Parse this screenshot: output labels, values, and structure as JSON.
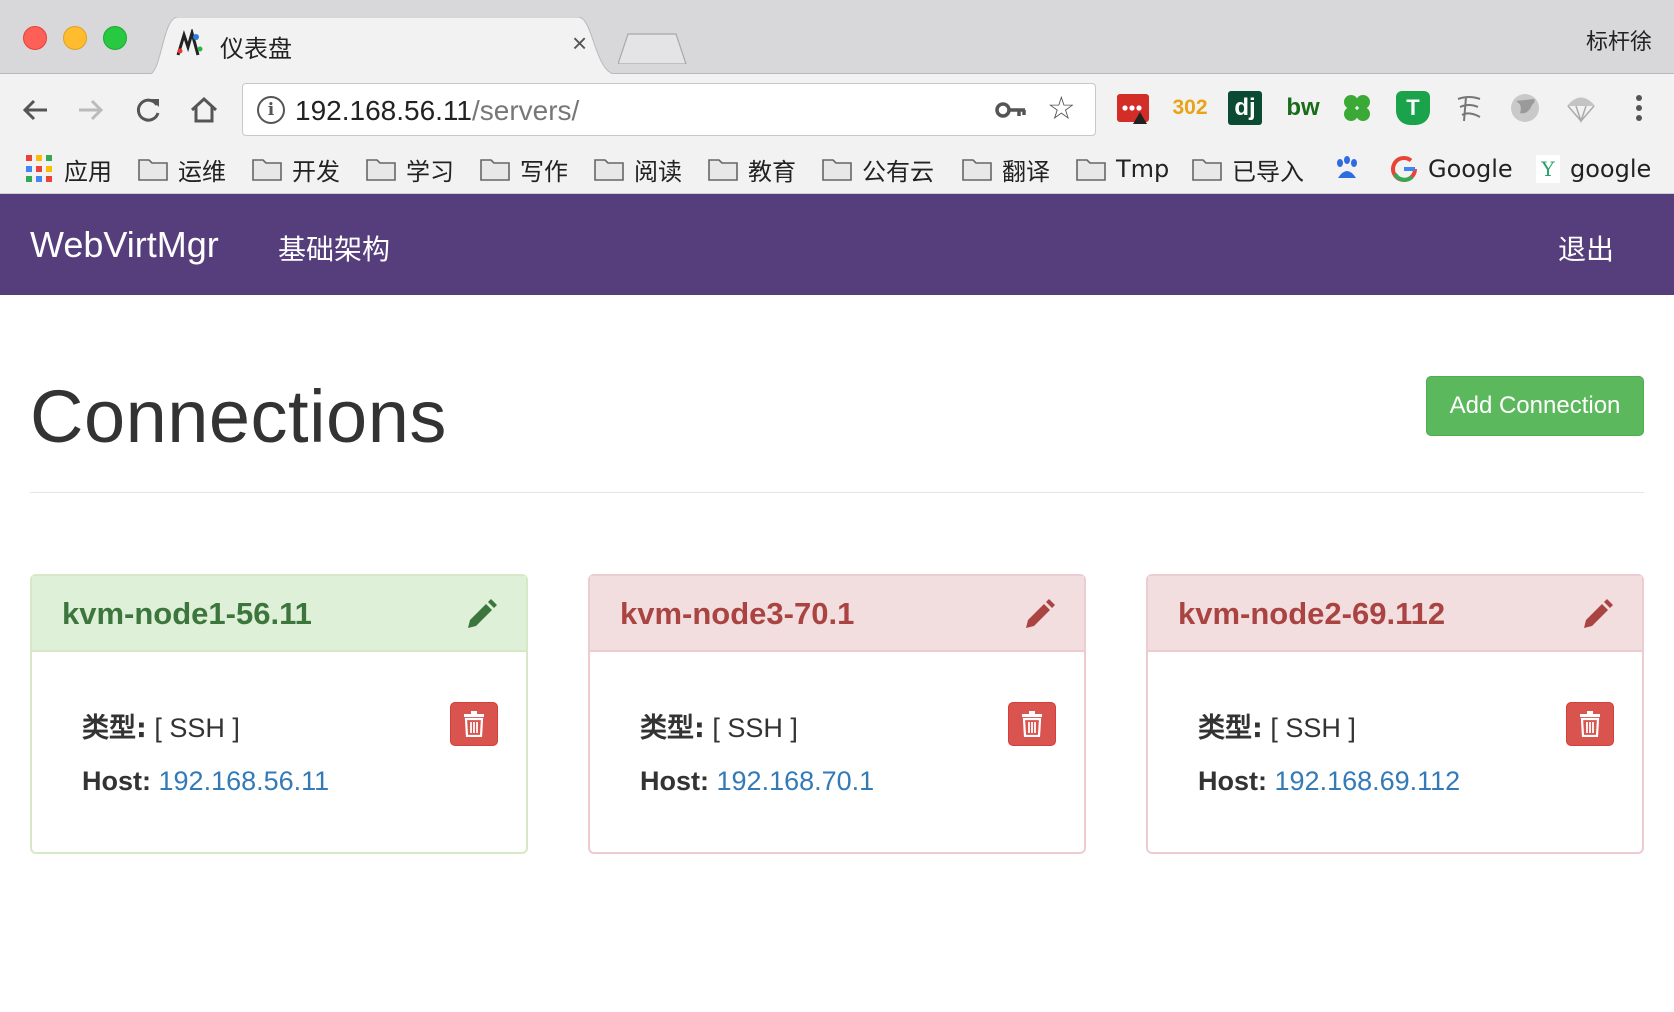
{
  "browser": {
    "tab_title": "仪表盘",
    "tab_close": "×",
    "profile_name": "标杆徐",
    "url_host": "192.168.56.11",
    "url_path": "/servers/",
    "info_glyph": "i",
    "bookmarks": [
      {
        "label": "应用",
        "kind": "apps"
      },
      {
        "label": "运维",
        "kind": "folder"
      },
      {
        "label": "开发",
        "kind": "folder"
      },
      {
        "label": "学习",
        "kind": "folder"
      },
      {
        "label": "写作",
        "kind": "folder"
      },
      {
        "label": "阅读",
        "kind": "folder"
      },
      {
        "label": "教育",
        "kind": "folder"
      },
      {
        "label": "公有云",
        "kind": "folder"
      },
      {
        "label": "翻译",
        "kind": "folder"
      },
      {
        "label": "Tmp",
        "kind": "folder"
      },
      {
        "label": "已导入",
        "kind": "folder"
      },
      {
        "label": "Google",
        "kind": "google"
      },
      {
        "label": "google",
        "kind": "yahoo"
      }
    ],
    "extensions": {
      "ext2_text": "302",
      "ext3_text": "dj",
      "ext4_text": "bw",
      "ext6_text": "T"
    }
  },
  "navbar": {
    "brand": "WebVirtMgr",
    "link": "基础架构",
    "logout": "退出"
  },
  "main": {
    "title": "Connections",
    "add_button": "Add Connection",
    "type_label": "类型:",
    "host_label": "Host:",
    "connections": [
      {
        "name": "kvm-node1-56.11",
        "type": "[ SSH ]",
        "host": "192.168.56.11",
        "status": "success"
      },
      {
        "name": "kvm-node3-70.1",
        "type": "[ SSH ]",
        "host": "192.168.70.1",
        "status": "danger"
      },
      {
        "name": "kvm-node2-69.112",
        "type": "[ SSH ]",
        "host": "192.168.69.112",
        "status": "danger"
      }
    ]
  },
  "colors": {
    "navbar": "#563d7c",
    "success_button": "#5cb85c",
    "danger_button": "#d9534f",
    "link": "#337ab7"
  }
}
